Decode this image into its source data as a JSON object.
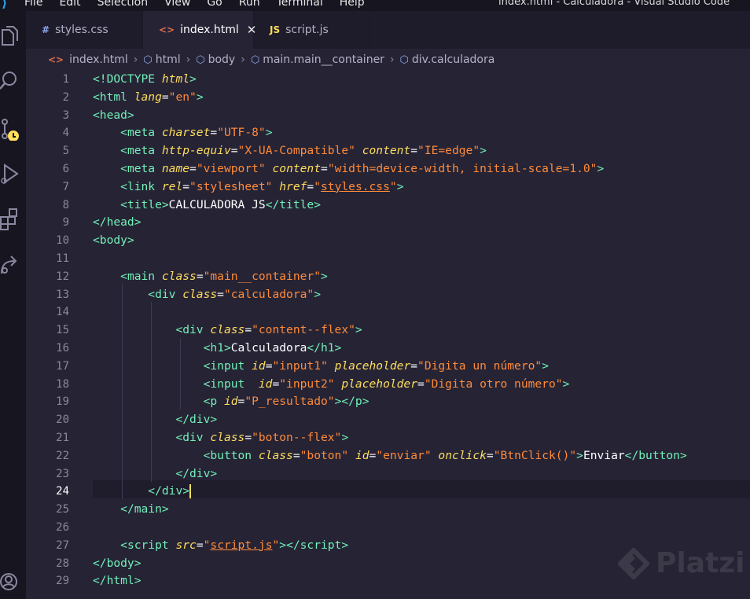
{
  "menubar": {
    "items": [
      "File",
      "Edit",
      "Selection",
      "View",
      "Go",
      "Run",
      "Terminal",
      "Help"
    ],
    "window_title": "index.html - Calculadora - Visual Studio Code"
  },
  "tabs": [
    {
      "icon": "#",
      "label": "styles.css"
    },
    {
      "icon": "<>",
      "label": "index.html",
      "close": "✕"
    },
    {
      "icon": "JS",
      "label": "script.js"
    }
  ],
  "breadcrumb": [
    "index.html",
    "html",
    "body",
    "main.main__container",
    "div.calculadora"
  ],
  "editor": {
    "line_numbers": [
      "1",
      "2",
      "3",
      "4",
      "5",
      "6",
      "7",
      "8",
      "9",
      "10",
      "11",
      "12",
      "13",
      "14",
      "15",
      "16",
      "17",
      "18",
      "19",
      "20",
      "21",
      "22",
      "23",
      "24",
      "25",
      "26",
      "27",
      "28",
      "29"
    ],
    "current_line": 24
  },
  "watermark": "Platzi",
  "colors": {
    "background": "#262335",
    "tag": "#72f1b8",
    "attribute": "#fede5d",
    "string": "#ff8b39"
  }
}
